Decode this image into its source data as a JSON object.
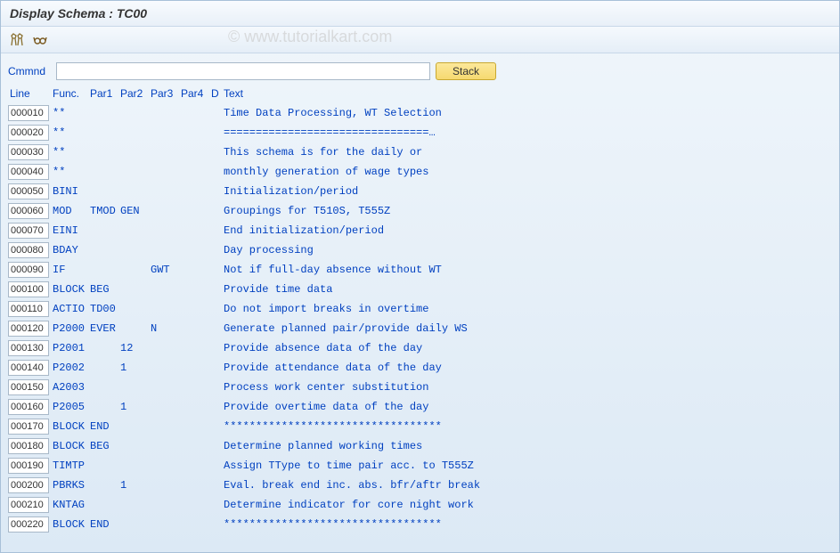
{
  "title": "Display Schema : TC00",
  "watermark": "© www.tutorialkart.com",
  "command": {
    "label": "Cmmnd",
    "value": "",
    "stack_label": "Stack"
  },
  "headers": {
    "line": "Line",
    "func": "Func.",
    "par1": "Par1",
    "par2": "Par2",
    "par3": "Par3",
    "par4": "Par4",
    "d": "D",
    "text": "Text"
  },
  "rows": [
    {
      "line": "000010",
      "func": "**",
      "par1": "",
      "par2": "",
      "par3": "",
      "par4": "",
      "d": "",
      "text": "Time Data Processing, WT Selection"
    },
    {
      "line": "000020",
      "func": "**",
      "par1": "",
      "par2": "",
      "par3": "",
      "par4": "",
      "d": "",
      "text": "================================…"
    },
    {
      "line": "000030",
      "func": "**",
      "par1": "",
      "par2": "",
      "par3": "",
      "par4": "",
      "d": "",
      "text": "This schema is for the daily or"
    },
    {
      "line": "000040",
      "func": "**",
      "par1": "",
      "par2": "",
      "par3": "",
      "par4": "",
      "d": "",
      "text": "monthly generation of wage types"
    },
    {
      "line": "000050",
      "func": "BINI",
      "par1": "",
      "par2": "",
      "par3": "",
      "par4": "",
      "d": "",
      "text": "Initialization/period"
    },
    {
      "line": "000060",
      "func": "MOD",
      "par1": "TMOD",
      "par2": "GEN",
      "par3": "",
      "par4": "",
      "d": "",
      "text": "Groupings for T510S, T555Z"
    },
    {
      "line": "000070",
      "func": "EINI",
      "par1": "",
      "par2": "",
      "par3": "",
      "par4": "",
      "d": "",
      "text": "End initialization/period"
    },
    {
      "line": "000080",
      "func": "BDAY",
      "par1": "",
      "par2": "",
      "par3": "",
      "par4": "",
      "d": "",
      "text": "Day processing"
    },
    {
      "line": "000090",
      "func": "IF",
      "par1": "",
      "par2": "",
      "par3": "GWT",
      "par4": "",
      "d": "",
      "text": "Not if full-day absence without WT"
    },
    {
      "line": "000100",
      "func": "BLOCK",
      "par1": "BEG",
      "par2": "",
      "par3": "",
      "par4": "",
      "d": "",
      "text": "Provide time data"
    },
    {
      "line": "000110",
      "func": "ACTIO",
      "par1": "TD00",
      "par2": "",
      "par3": "",
      "par4": "",
      "d": "",
      "text": "Do not import breaks in overtime"
    },
    {
      "line": "000120",
      "func": "P2000",
      "par1": "EVER",
      "par2": "",
      "par3": "N",
      "par4": "",
      "d": "",
      "text": "Generate planned pair/provide daily WS"
    },
    {
      "line": "000130",
      "func": "P2001",
      "par1": "",
      "par2": "12",
      "par3": "",
      "par4": "",
      "d": "",
      "text": "Provide absence data of the day"
    },
    {
      "line": "000140",
      "func": "P2002",
      "par1": "",
      "par2": "1",
      "par3": "",
      "par4": "",
      "d": "",
      "text": "Provide attendance data of the day"
    },
    {
      "line": "000150",
      "func": "A2003",
      "par1": "",
      "par2": "",
      "par3": "",
      "par4": "",
      "d": "",
      "text": "Process work center substitution"
    },
    {
      "line": "000160",
      "func": "P2005",
      "par1": "",
      "par2": "1",
      "par3": "",
      "par4": "",
      "d": "",
      "text": "Provide overtime data of the day"
    },
    {
      "line": "000170",
      "func": "BLOCK",
      "par1": "END",
      "par2": "",
      "par3": "",
      "par4": "",
      "d": "",
      "text": "**********************************"
    },
    {
      "line": "000180",
      "func": "BLOCK",
      "par1": "BEG",
      "par2": "",
      "par3": "",
      "par4": "",
      "d": "",
      "text": "Determine planned working times"
    },
    {
      "line": "000190",
      "func": "TIMTP",
      "par1": "",
      "par2": "",
      "par3": "",
      "par4": "",
      "d": "",
      "text": "Assign TType to time pair acc. to T555Z"
    },
    {
      "line": "000200",
      "func": "PBRKS",
      "par1": "",
      "par2": "1",
      "par3": "",
      "par4": "",
      "d": "",
      "text": "Eval. break end inc. abs. bfr/aftr break"
    },
    {
      "line": "000210",
      "func": "KNTAG",
      "par1": "",
      "par2": "",
      "par3": "",
      "par4": "",
      "d": "",
      "text": "Determine indicator for core night work"
    },
    {
      "line": "000220",
      "func": "BLOCK",
      "par1": "END",
      "par2": "",
      "par3": "",
      "par4": "",
      "d": "",
      "text": "**********************************"
    }
  ]
}
